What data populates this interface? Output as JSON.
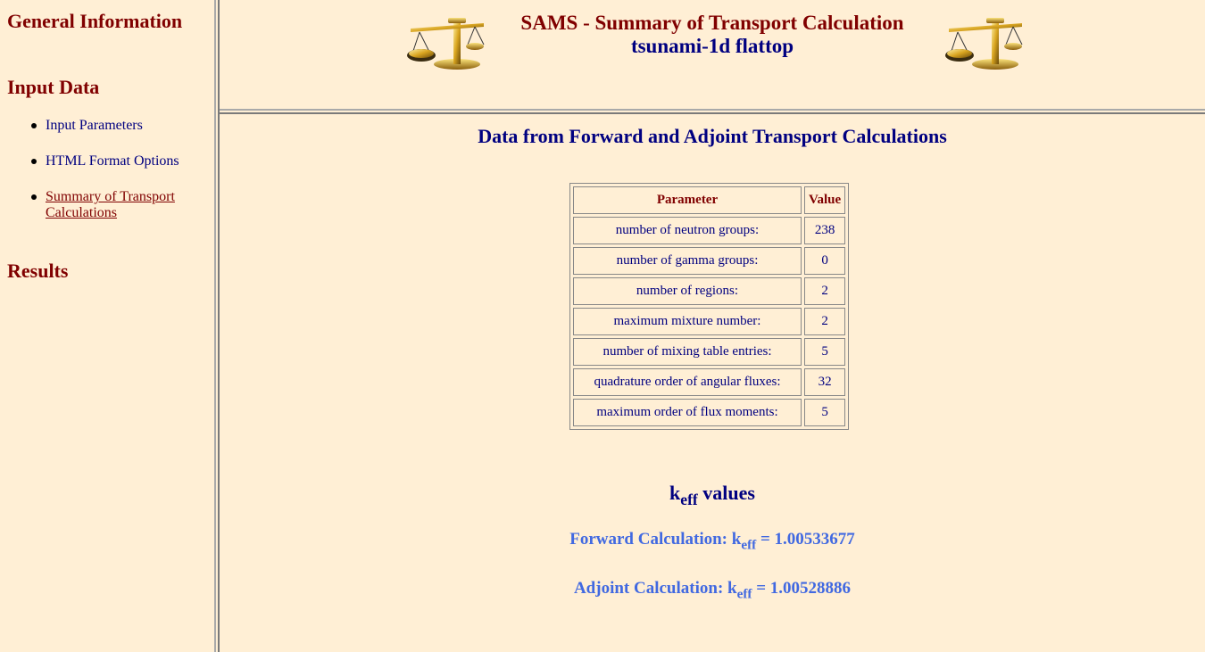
{
  "nav": {
    "general_information": "General Information",
    "input_data": "Input Data",
    "items": [
      {
        "label": "Input Parameters"
      },
      {
        "label": "HTML Format Options"
      },
      {
        "label": "Summary of Transport Calculations"
      }
    ],
    "results": "Results"
  },
  "header": {
    "title": "SAMS - Summary of Transport Calculation",
    "subtitle": "tsunami-1d flattop",
    "logo_icon": "balance-scale-icon"
  },
  "main": {
    "heading": "Data from Forward and Adjoint Transport Calculations",
    "table": {
      "headers": [
        "Parameter",
        "Value"
      ],
      "rows": [
        {
          "param": "number of neutron groups:",
          "value": "238"
        },
        {
          "param": "number of gamma groups:",
          "value": "0"
        },
        {
          "param": "number of regions:",
          "value": "2"
        },
        {
          "param": "maximum mixture number:",
          "value": "2"
        },
        {
          "param": "number of mixing table entries:",
          "value": "5"
        },
        {
          "param": "quadrature order of angular fluxes:",
          "value": "32"
        },
        {
          "param": "maximum order of flux moments:",
          "value": "5"
        }
      ]
    },
    "keff": {
      "heading_k": "k",
      "heading_sub": "eff",
      "heading_rest": " values",
      "forward_label": "Forward Calculation: k",
      "forward_sub": "eff",
      "forward_value": " = 1.00533677",
      "adjoint_label": "Adjoint Calculation: k",
      "adjoint_sub": "eff",
      "adjoint_value": " = 1.00528886"
    }
  },
  "colors": {
    "background": "#ffefd5",
    "heading_maroon": "#800000",
    "navy": "#000080",
    "keff_blue": "#4169e1"
  }
}
